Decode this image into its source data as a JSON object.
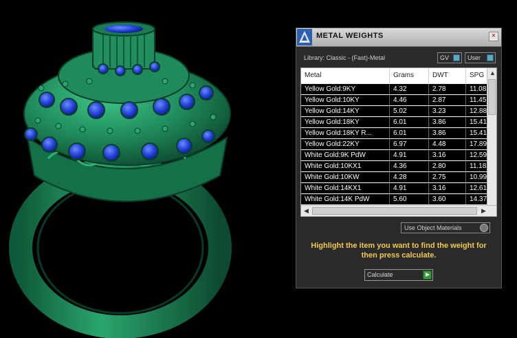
{
  "window": {
    "title": "METAL WEIGHTS",
    "close_icon": "close-icon",
    "logo_icon": "app-logo-icon"
  },
  "library": {
    "label": "Library: Classic - (Fast)-Metal",
    "gv_label": "GV",
    "user_label": "User"
  },
  "table": {
    "columns": [
      "Metal",
      "Grams",
      "DWT",
      "SPG"
    ],
    "rows": [
      [
        "Yellow Gold:9KY",
        "4.32",
        "2.78",
        "11.08"
      ],
      [
        "Yellow Gold:10KY",
        "4.46",
        "2.87",
        "11.45"
      ],
      [
        "Yellow Gold:14KY",
        "5.02",
        "3.23",
        "12.88"
      ],
      [
        "Yellow Gold:18KY",
        "6.01",
        "3.86",
        "15.41"
      ],
      [
        "Yellow Gold:18KY R...",
        "6.01",
        "3.86",
        "15.41"
      ],
      [
        "Yellow Gold:22KY",
        "6.97",
        "4.48",
        "17.89"
      ],
      [
        "White Gold:9K PdW",
        "4.91",
        "3.16",
        "12.59"
      ],
      [
        "White Gold:10KX1",
        "4.36",
        "2.80",
        "11.18"
      ],
      [
        "White Gold:10KW",
        "4.28",
        "2.75",
        "10.99"
      ],
      [
        "White Gold:14KX1",
        "4.91",
        "3.16",
        "12.61"
      ],
      [
        "White Gold:14K PdW",
        "5.60",
        "3.60",
        "14.37"
      ]
    ]
  },
  "options": {
    "use_object_materials": "Use Object Materials"
  },
  "instruction": "Highlight the item you want to find the weight for then press calculate.",
  "calculate_label": "Calculate",
  "colors": {
    "ring_green": "#1f8a5c",
    "gem_blue": "#1f3fd1",
    "panel_bg": "#2b2b2b",
    "instruction_yellow": "#f2c94c"
  }
}
